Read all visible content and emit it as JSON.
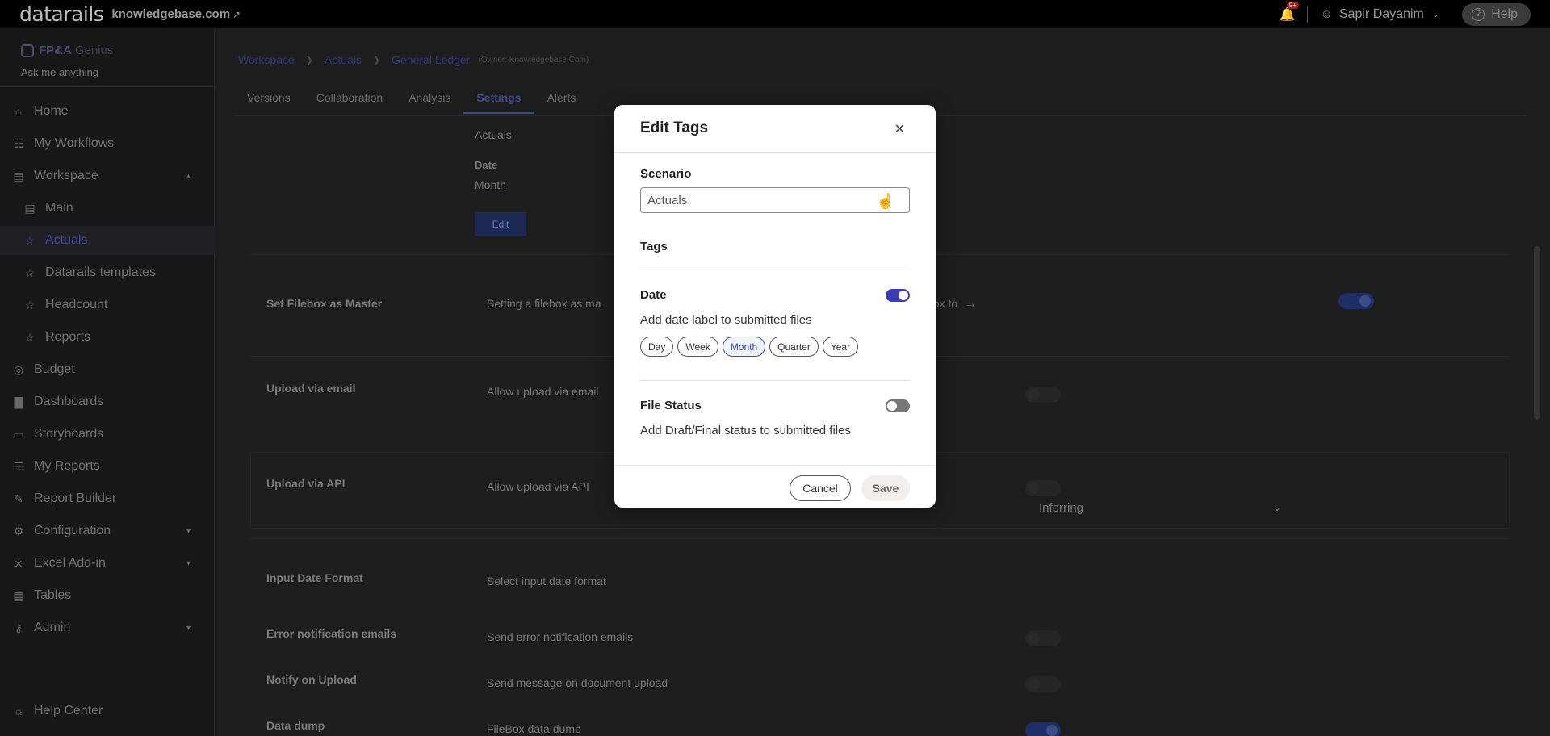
{
  "topbar": {
    "logo": "datarails",
    "domain": "knowledgebase.com",
    "notification_count": "9+",
    "user_name": "Sapir Dayanim",
    "help_label": "Help"
  },
  "sidebar": {
    "genius_brand": "FP&A",
    "genius_word": "Genius",
    "ask_placeholder": "Ask me anything",
    "items": [
      {
        "label": "Home",
        "icon": "home-icon"
      },
      {
        "label": "My Workflows",
        "icon": "clipboard-icon"
      },
      {
        "label": "Workspace",
        "icon": "folder-icon"
      },
      {
        "label": "Main",
        "icon": "folder-icon"
      },
      {
        "label": "Actuals",
        "icon": "star-icon"
      },
      {
        "label": "Datarails templates",
        "icon": "star-icon"
      },
      {
        "label": "Headcount",
        "icon": "star-icon"
      },
      {
        "label": "Reports",
        "icon": "star-icon"
      },
      {
        "label": "Budget",
        "icon": "coins-icon"
      },
      {
        "label": "Dashboards",
        "icon": "bar-chart-icon"
      },
      {
        "label": "Storyboards",
        "icon": "presentation-icon"
      },
      {
        "label": "My Reports",
        "icon": "document-icon"
      },
      {
        "label": "Report Builder",
        "icon": "edit-icon"
      },
      {
        "label": "Configuration",
        "icon": "gear-icon"
      },
      {
        "label": "Excel Add-in",
        "icon": "excel-icon"
      },
      {
        "label": "Tables",
        "icon": "table-icon"
      },
      {
        "label": "Admin",
        "icon": "key-icon"
      },
      {
        "label": "Help Center",
        "icon": "lightbulb-icon"
      }
    ]
  },
  "breadcrumb": {
    "items": [
      "Workspace",
      "Actuals",
      "General Ledger"
    ],
    "owner": "(Owner: Knowledgebase.Com)"
  },
  "tabs": [
    "Versions",
    "Collaboration",
    "Analysis",
    "Settings",
    "Alerts"
  ],
  "settings": {
    "scenario_value": "Actuals",
    "date_label": "Date",
    "date_value": "Month",
    "edit_label": "Edit",
    "rows": [
      {
        "label": "Set Filebox as Master",
        "desc": "Setting a filebox as ma",
        "desc_tail": "box to",
        "toggle": true
      },
      {
        "label": "Upload via email",
        "desc": "Allow upload via email",
        "toggle": false
      },
      {
        "label": "Upload via API",
        "desc": "Allow upload via API",
        "toggle": false
      },
      {
        "label": "Input Date Format",
        "desc": "Select input date format",
        "select": "Inferring"
      },
      {
        "label": "Error notification emails",
        "desc": "Send error notification emails",
        "toggle": false
      },
      {
        "label": "Notify on Upload",
        "desc": "Send message on document upload",
        "toggle": false
      },
      {
        "label": "Data dump",
        "desc": "FileBox data dump",
        "toggle": true
      }
    ]
  },
  "modal": {
    "title": "Edit Tags",
    "scenario_label": "Scenario",
    "scenario_value": "Actuals",
    "tags_label": "Tags",
    "date_label": "Date",
    "date_desc": "Add date label to submitted files",
    "date_enabled": true,
    "date_options": [
      "Day",
      "Week",
      "Month",
      "Quarter",
      "Year"
    ],
    "date_selected": "Month",
    "status_label": "File Status",
    "status_desc": "Add Draft/Final status to submitted files",
    "status_enabled": false,
    "cancel_label": "Cancel",
    "save_label": "Save"
  }
}
